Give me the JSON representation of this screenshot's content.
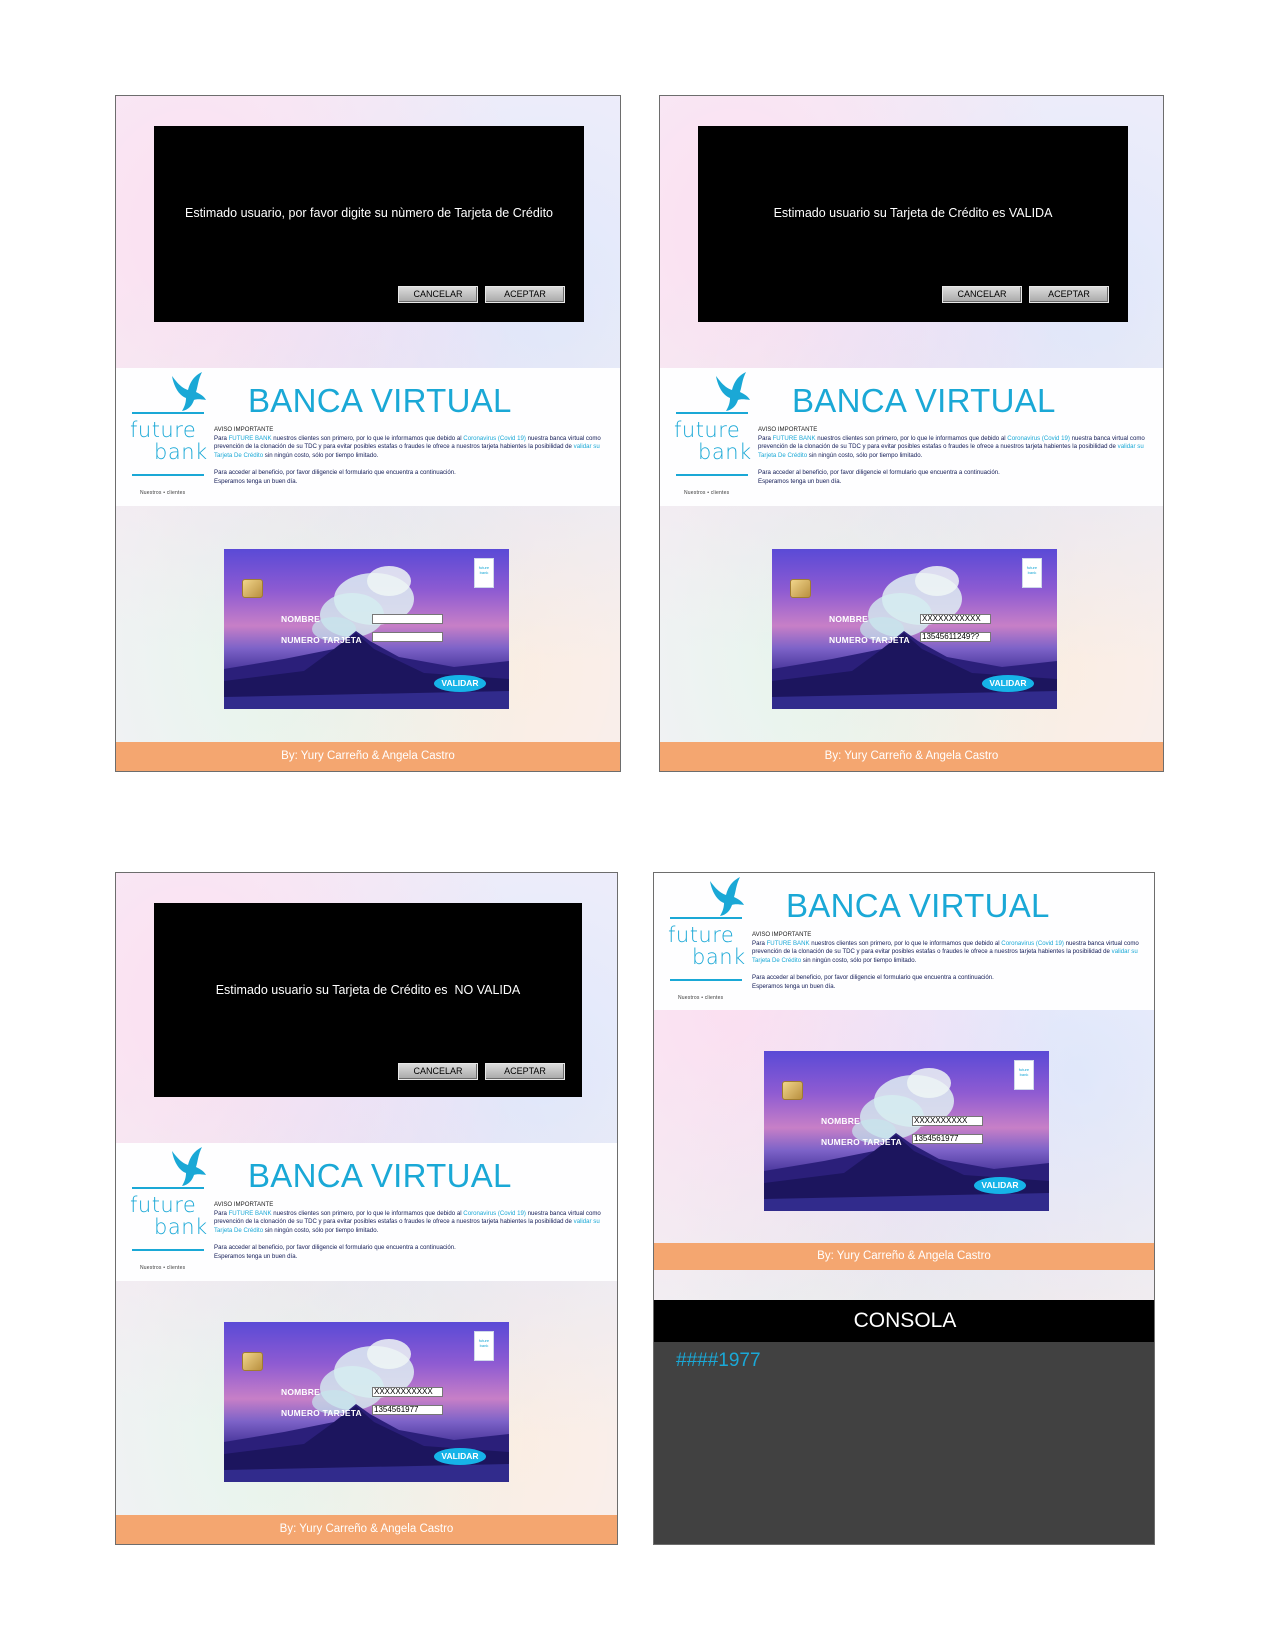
{
  "colors": {
    "accent": "#1aa8d6",
    "dialog_bg": "#000000",
    "footer_bg": "#f4a670",
    "console_bg": "#414141",
    "validar_button": "#16b3e8"
  },
  "icons": [
    "bird-logo-icon",
    "chip-icon",
    "card-logo-icon",
    "mountain-illustration"
  ],
  "common": {
    "dialog": {
      "cancel_label": "CANCELAR",
      "accept_label": "ACEPTAR"
    },
    "logo": {
      "word_1": "future",
      "word_2": "bank",
      "tagline": "Nuestros • clientes"
    },
    "banner": {
      "title": "BANCA VIRTUAL",
      "notice_title": "AVISO IMPORTANTE",
      "notice_p1_a": "Para ",
      "notice_p1_bank": "FUTURE BANK",
      "notice_p1_b": " nuestros clientes son primero, por lo que le informamos que debido al ",
      "notice_p1_covid": "Coronavirus (Covid 19)",
      "notice_p1_c": " nuestra banca virtual como prevención de la clonación de su TDC y para evitar posibles estafas o fraudes le ofrece a nuestros tarjeta habientes la posibilidad de ",
      "notice_p1_link": "validar su Tarjeta De Crédito",
      "notice_p1_d": " sin ningún costo, sólo por tiempo limitado.",
      "notice_p2": "Para acceder al beneficio, por favor diligencie el formulario que encuentra a continuación.",
      "notice_p3": "Esperamos tenga un buen día."
    },
    "card": {
      "name_label": "NOMBRE",
      "number_label": "NUMERO TARJETA",
      "validar_label": "VALIDAR",
      "logo_text": "future bank"
    },
    "footer": "By: Yury Carreño & Angela Castro"
  },
  "panel_1": {
    "dialog_message": "Estimado usuario, por favor digite su nùmero de Tarjeta de Crédito",
    "card": {
      "name_value": "",
      "number_value": ""
    }
  },
  "panel_2": {
    "dialog_message": "Estimado usuario su Tarjeta de Crédito es VALIDA",
    "card": {
      "name_value": "XXXXXXXXXXX",
      "number_value": "13545611249??"
    }
  },
  "panel_3": {
    "dialog_message": "Estimado usuario su Tarjeta de Crédito es  NO VALIDA",
    "card": {
      "name_value": "XXXXXXXXXXX",
      "number_value": "1354561977"
    }
  },
  "panel_4": {
    "card": {
      "name_value": "XXXXXXXXXX",
      "number_value": "1354561977"
    },
    "console_title": "CONSOLA",
    "console_output": "####1977"
  }
}
